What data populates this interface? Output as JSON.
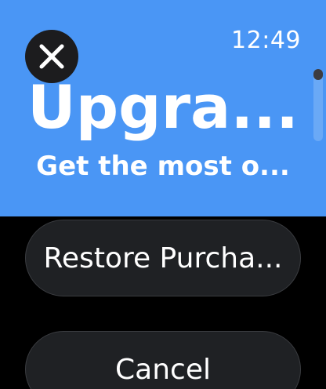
{
  "status": {
    "time": "12:49"
  },
  "hero": {
    "title": "Upgra...",
    "subtitle": "Get the most o...",
    "background_color": "#4a96f5"
  },
  "actions": {
    "restore_label": "Restore Purcha...",
    "cancel_label": "Cancel"
  },
  "icons": {
    "close": "close-icon"
  }
}
